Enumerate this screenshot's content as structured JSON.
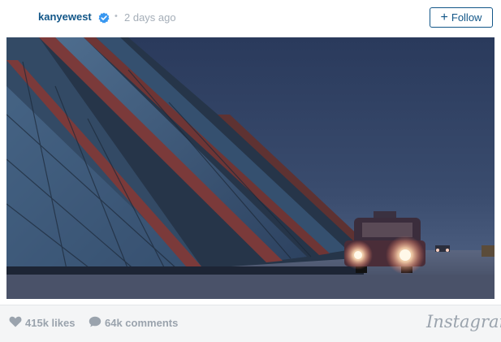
{
  "header": {
    "username": "kanyewest",
    "separator": "•",
    "time_ago": "2 days ago",
    "follow_label": "Follow",
    "follow_icon": "+",
    "verified_icon": "verified-badge-icon"
  },
  "post": {
    "image_icon": "photo"
  },
  "footer": {
    "likes": "415k likes",
    "comments": "64k comments",
    "brand": "Instagram",
    "like_icon": "heart-icon",
    "comment_icon": "speech-bubble-icon"
  },
  "colors": {
    "link": "#125688",
    "muted": "#a5aeb8",
    "footer_bg": "#f4f5f6"
  }
}
